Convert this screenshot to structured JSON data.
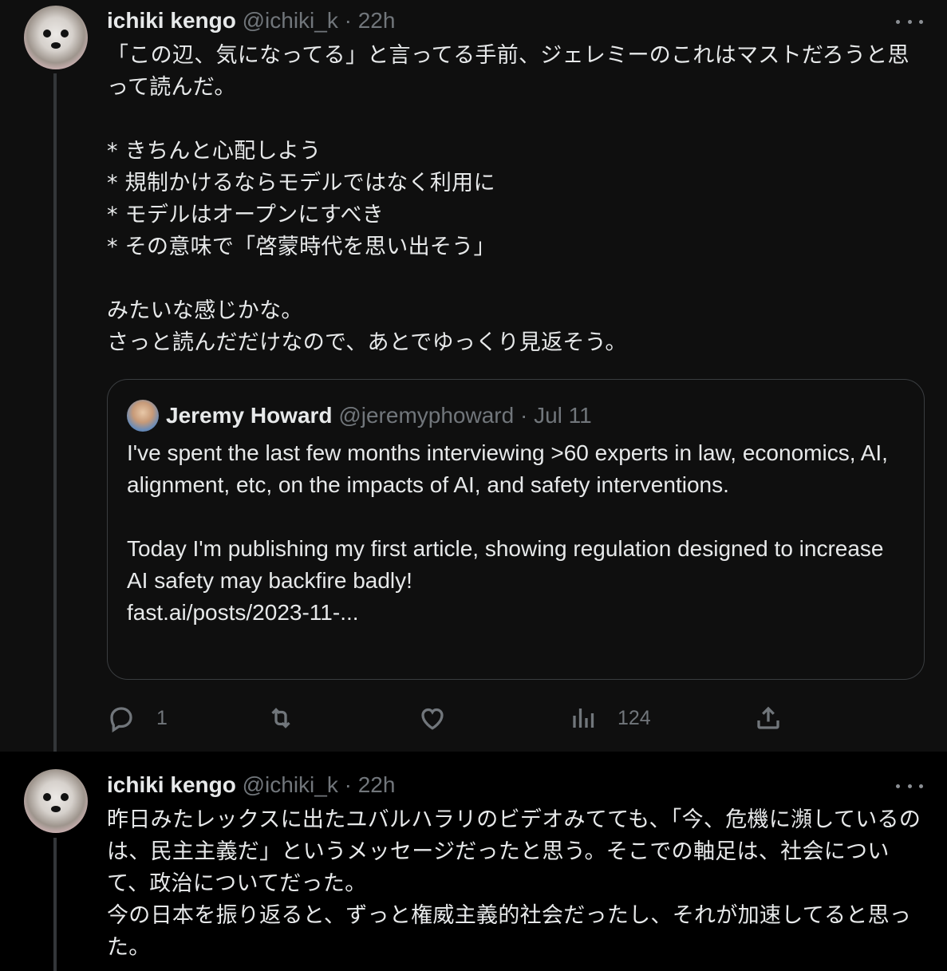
{
  "tweets": [
    {
      "author": {
        "name": "ichiki kengo",
        "handle": "@ichiki_k"
      },
      "separator": "·",
      "time": "22h",
      "body": "「この辺、気になってる」と言ってる手前、ジェレミーのこれはマストだろうと思って読んだ。\n\n* きちんと心配しよう\n* 規制かけるならモデルではなく利用に\n* モデルはオープンにすべき\n* その意味で「啓蒙時代を思い出そう」\n\nみたいな感じかな。\nさっと読んだだけなので、あとでゆっくり見返そう。",
      "quoted": {
        "author": {
          "name": "Jeremy Howard",
          "handle": "@jeremyphoward"
        },
        "separator": "·",
        "time": "Jul 11",
        "body": "I've spent the last few months interviewing >60 experts in law, economics, AI, alignment, etc, on the impacts of AI, and safety interventions.\n\nToday I'm publishing my first article, showing regulation designed to increase AI safety may backfire badly!\nfast.ai/posts/2023-11-..."
      },
      "actions": {
        "reply_count": "1",
        "retweet_count": "",
        "like_count": "",
        "views_count": "124"
      }
    },
    {
      "author": {
        "name": "ichiki kengo",
        "handle": "@ichiki_k"
      },
      "separator": "·",
      "time": "22h",
      "body": "昨日みたレックスに出たユバルハラリのビデオみてても、「今、危機に瀕しているのは、民主主義だ」というメッセージだったと思う。そこでの軸足は、社会について、政治についてだった。\n今の日本を振り返ると、ずっと権威主義的社会だったし、それが加速してると思った。"
    }
  ],
  "icons": [
    "more-icon",
    "reply-icon",
    "retweet-icon",
    "like-icon",
    "views-icon",
    "share-icon"
  ],
  "colors": {
    "background": "#000000",
    "text": "#e7e9ea",
    "muted": "#71767b",
    "border": "#3a3d40"
  }
}
